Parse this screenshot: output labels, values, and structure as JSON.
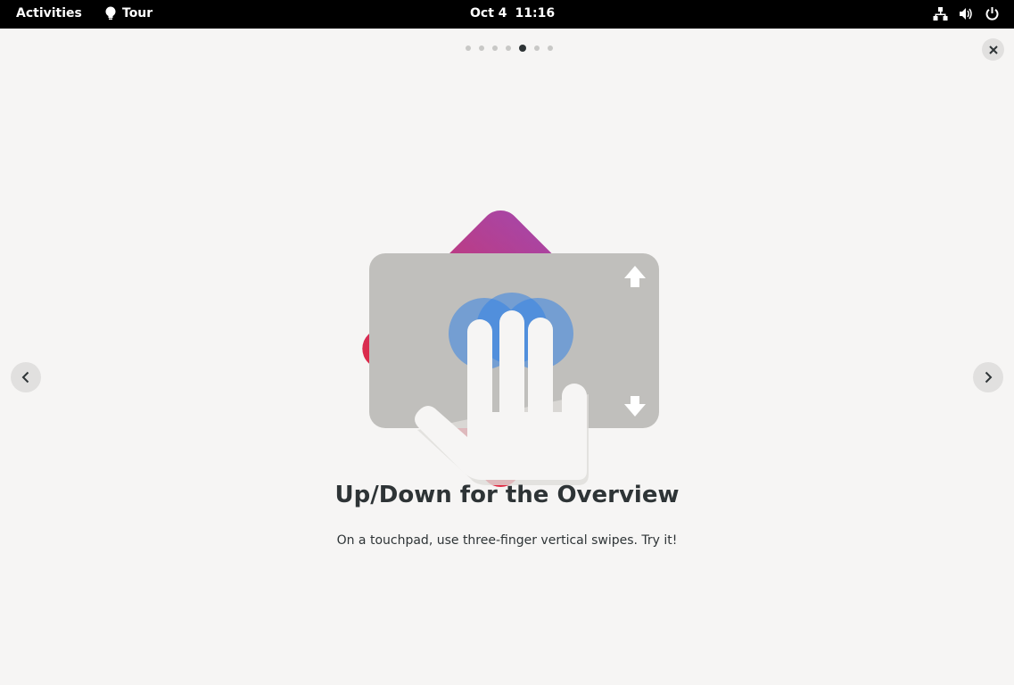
{
  "topbar": {
    "activities_label": "Activities",
    "app_name": "Tour",
    "date": "Oct 4",
    "time": "11:16",
    "tray_icons": [
      "network-wired-icon",
      "volume-icon",
      "power-icon"
    ]
  },
  "pager": {
    "total_pages": 7,
    "current_page": 5
  },
  "page": {
    "title": "Up/Down for the Overview",
    "description": "On a touchpad, use three-finger vertical swipes. Try it!"
  },
  "colors": {
    "background": "#f6f5f4",
    "topbar": "#000000",
    "text": "#2e3436",
    "gradient_top": "#9141ac",
    "gradient_bottom": "#e01b24",
    "touchpad": "#c0bfbc",
    "touch_blue": "#3584e4",
    "hand": "#f6f5f4"
  }
}
